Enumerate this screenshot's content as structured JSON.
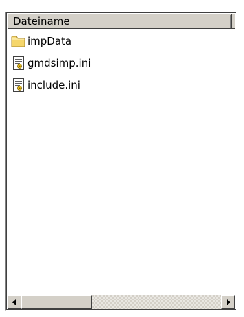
{
  "listview": {
    "column_header": "Dateiname",
    "items": [
      {
        "label": "impData",
        "icon": "folder-icon"
      },
      {
        "label": "gmdsimp.ini",
        "icon": "settings-file-icon"
      },
      {
        "label": "include.ini",
        "icon": "settings-file-icon"
      }
    ]
  },
  "scrollbar": {
    "left_arrow": "◀",
    "right_arrow": "▶"
  },
  "colors": {
    "face": "#d4d0c8",
    "folder_yellow": "#f5d66b",
    "window_bg": "#ffffff"
  }
}
